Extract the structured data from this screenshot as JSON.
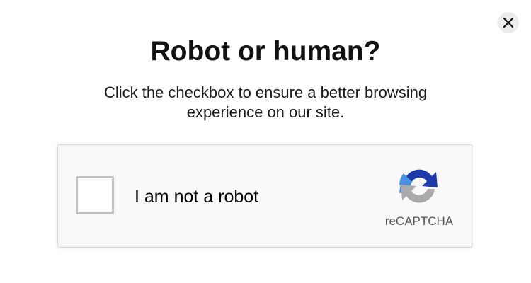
{
  "dialog": {
    "title": "Robot or human?",
    "subtitle": "Click the checkbox to ensure a better browsing experience on our site.",
    "close_icon": "close-icon"
  },
  "captcha": {
    "label": "I am not a robot",
    "checked": false,
    "brand": "reCAPTCHA",
    "logo_icon": "recaptcha-logo-icon"
  },
  "colors": {
    "logo_dark_blue": "#1c3aa9",
    "logo_light_blue": "#4a90e2",
    "logo_gray": "#aaaaaa",
    "checkbox_border": "#c1c1c1",
    "close_button_bg": "#ececec"
  }
}
